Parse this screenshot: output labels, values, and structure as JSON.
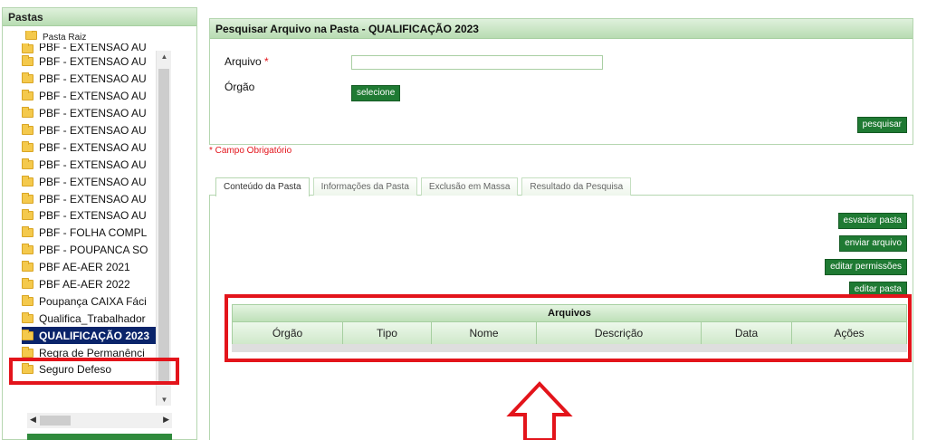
{
  "sidebar": {
    "title": "Pastas",
    "root_label": "Pasta Raiz",
    "items": [
      {
        "label": "PBF - EXTENSAO AU",
        "clipped": true
      },
      {
        "label": "PBF - EXTENSAO AU"
      },
      {
        "label": "PBF - EXTENSAO AU"
      },
      {
        "label": "PBF - EXTENSAO AU"
      },
      {
        "label": "PBF - EXTENSAO AU"
      },
      {
        "label": "PBF - EXTENSAO AU"
      },
      {
        "label": "PBF - EXTENSAO AU"
      },
      {
        "label": "PBF - EXTENSAO AU"
      },
      {
        "label": "PBF - EXTENSAO AU"
      },
      {
        "label": "PBF - EXTENSAO AU"
      },
      {
        "label": "PBF - EXTENSAO AU"
      },
      {
        "label": "PBF - FOLHA COMPL"
      },
      {
        "label": "PBF - POUPANCA SO"
      },
      {
        "label": "PBF AE-AER 2021"
      },
      {
        "label": "PBF AE-AER 2022"
      },
      {
        "label": "Poupança CAIXA Fáci"
      },
      {
        "label": "Qualifica_Trabalhador"
      },
      {
        "label": "QUALIFICAÇÃO 2023",
        "selected": true
      },
      {
        "label": "Regra de Permanênci"
      },
      {
        "label": "Seguro Defeso"
      }
    ]
  },
  "search": {
    "title": "Pesquisar Arquivo na Pasta - QUALIFICAÇÃO 2023",
    "arquivo_label": "Arquivo",
    "required_marker": "*",
    "arquivo_value": "",
    "orgao_label": "Órgão",
    "select_button": "selecione",
    "search_button": "pesquisar"
  },
  "required_note": "* Campo Obrigatório",
  "tabs": [
    {
      "label": "Conteúdo da Pasta",
      "active": true
    },
    {
      "label": "Informações da Pasta"
    },
    {
      "label": "Exclusão em Massa"
    },
    {
      "label": "Resultado da Pesquisa"
    }
  ],
  "actions": {
    "empty_folder": "esvaziar pasta",
    "send_file": "enviar arquivo",
    "edit_permissions": "editar permissões",
    "edit_folder": "editar pasta"
  },
  "files_table": {
    "caption": "Arquivos",
    "columns": [
      "Órgão",
      "Tipo",
      "Nome",
      "Descrição",
      "Data",
      "Ações"
    ],
    "rows": []
  },
  "colors": {
    "accent_green": "#1f7a33",
    "highlight_red": "#e3141b",
    "selected_blue": "#0a246a"
  }
}
